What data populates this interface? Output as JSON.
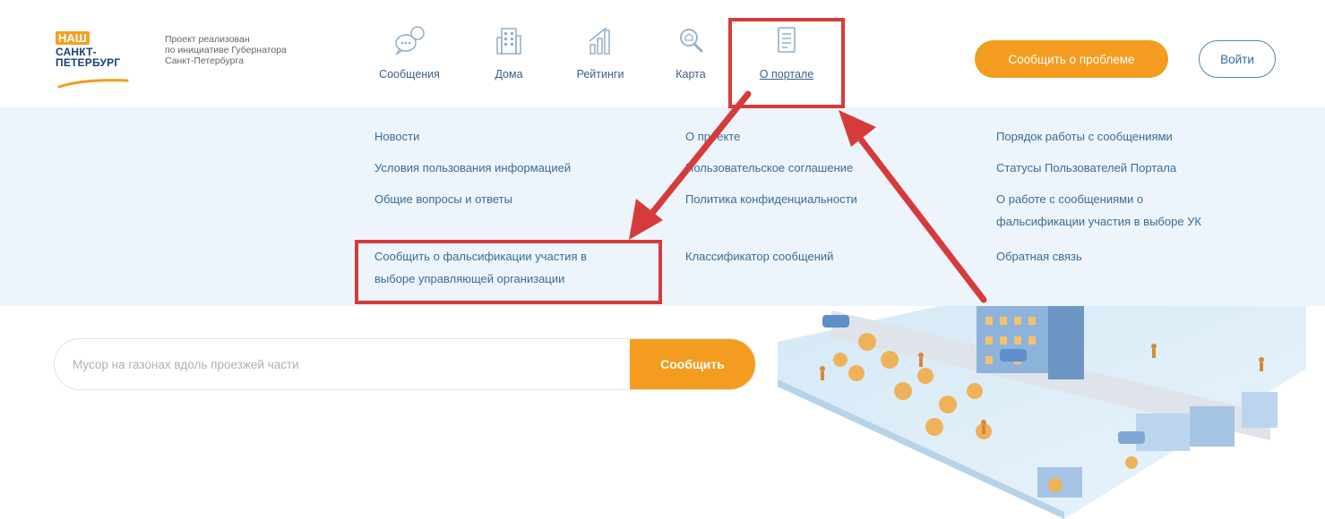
{
  "logo": {
    "line1": "НАШ",
    "line2": "САНКТ-",
    "line3": "ПЕТЕРБУРГ"
  },
  "project_note": {
    "line1": "Проект реализован",
    "line2": "по инициативе Губернатора",
    "line3": "Санкт-Петербурга"
  },
  "nav": [
    {
      "label": "Сообщения",
      "icon": "speech-bubbles-icon"
    },
    {
      "label": "Дома",
      "icon": "building-icon"
    },
    {
      "label": "Рейтинги",
      "icon": "bar-chart-icon"
    },
    {
      "label": "Карта",
      "icon": "magnifier-icon"
    },
    {
      "label": "О портале",
      "icon": "document-icon",
      "active": true
    }
  ],
  "header_buttons": {
    "report": "Сообщить о проблеме",
    "login": "Войти"
  },
  "dropdown": {
    "col1": [
      "Новости",
      "Условия пользования информацией",
      "Общие вопросы и ответы",
      "Сообщить о фальсификации участия в",
      "выборе управляющей организации"
    ],
    "col2": [
      "О проекте",
      "Пользовательское соглашение",
      "Политика конфиденциальности",
      "Классификатор сообщений"
    ],
    "col3": [
      "Порядок работы с сообщениями",
      "Статусы Пользователей Портала",
      "О работе с сообщениями о",
      "фальсификации участия в выборе УК",
      "Обратная связь"
    ]
  },
  "search": {
    "placeholder": "Мусор на газонах вдоль проезжей части",
    "button": "Сообщить"
  },
  "colors": {
    "accent": "#f39c1f",
    "link": "#3a6d97",
    "dropdown_bg": "#edf4fb",
    "annotation": "#d63b3b",
    "brand_blue": "#1a3e7a"
  }
}
